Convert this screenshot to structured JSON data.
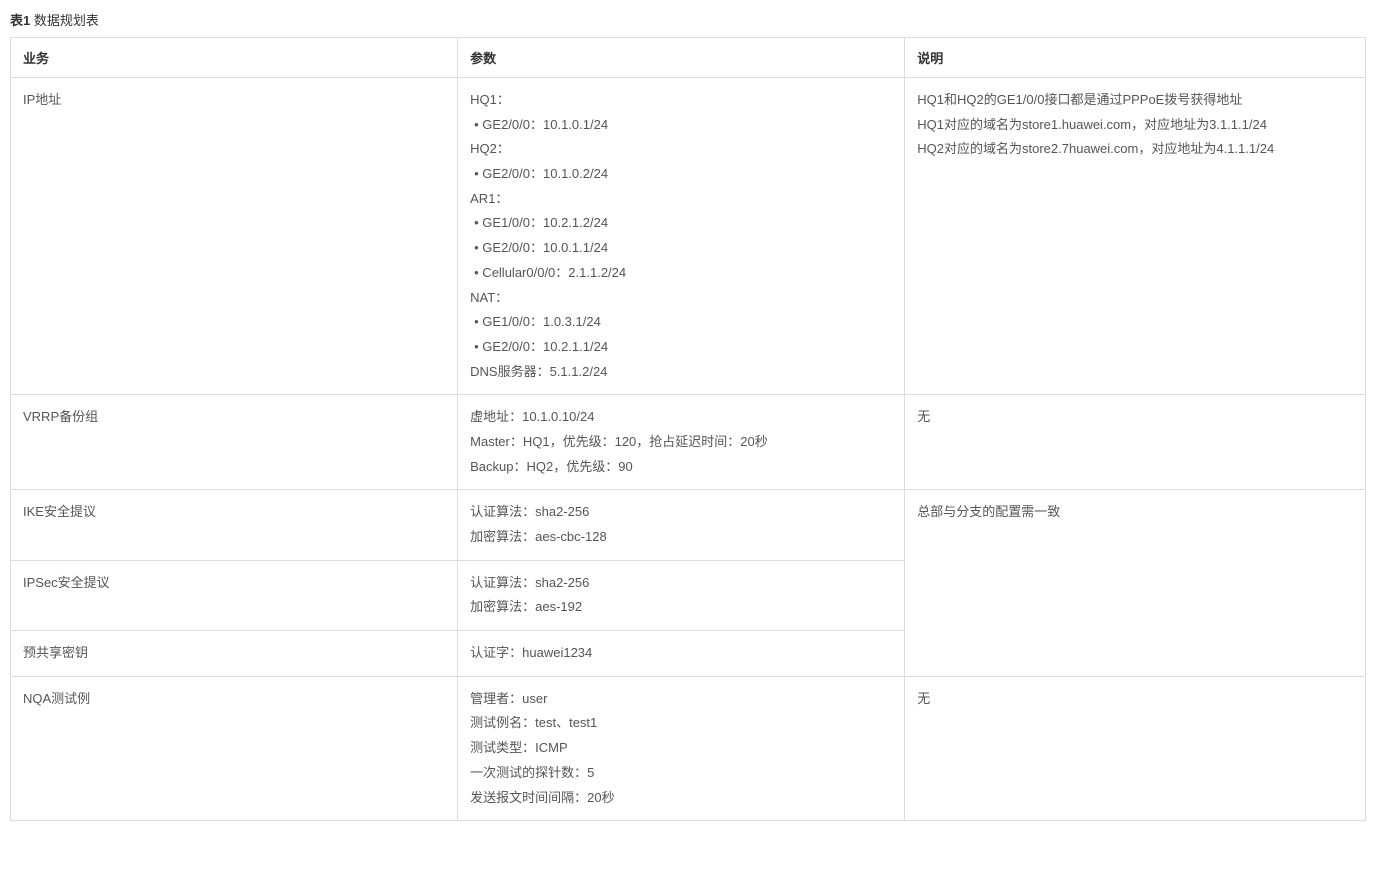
{
  "title_prefix": "表1",
  "title_text": " 数据规划表",
  "headers": {
    "col1": "业务",
    "col2": "参数",
    "col3": "说明"
  },
  "rows": {
    "ip": {
      "label": "IP地址",
      "params": {
        "hq1_label": "HQ1：",
        "hq1_ge2": "•  GE2/0/0：10.1.0.1/24",
        "hq2_label": "HQ2：",
        "hq2_ge2": "•  GE2/0/0：10.1.0.2/24",
        "ar1_label": "AR1：",
        "ar1_ge1": "•  GE1/0/0：10.2.1.2/24",
        "ar1_ge2": "•  GE2/0/0：10.0.1.1/24",
        "ar1_cell": "•  Cellular0/0/0：2.1.1.2/24",
        "nat_label": "NAT：",
        "nat_ge1": "•  GE1/0/0：1.0.3.1/24",
        "nat_ge2": "•  GE2/0/0：10.2.1.1/24",
        "dns": "DNS服务器：5.1.1.2/24"
      },
      "desc": {
        "line1": "HQ1和HQ2的GE1/0/0接口都是通过PPPoE拨号获得地址",
        "line2": "HQ1对应的域名为store1.huawei.com，对应地址为3.1.1.1/24",
        "line3": "HQ2对应的域名为store2.7huawei.com，对应地址为4.1.1.1/24"
      }
    },
    "vrrp": {
      "label": "VRRP备份组",
      "params": {
        "line1": "虚地址：10.1.0.10/24",
        "line2": "Master：HQ1，优先级：120，抢占延迟时间：20秒",
        "line3": "Backup：HQ2，优先级：90"
      },
      "desc": "无"
    },
    "ike": {
      "label": "IKE安全提议",
      "params": {
        "line1": "认证算法：sha2-256",
        "line2": "加密算法：aes-cbc-128"
      },
      "desc": "总部与分支的配置需一致"
    },
    "ipsec": {
      "label": "IPSec安全提议",
      "params": {
        "line1": "认证算法：sha2-256",
        "line2": "加密算法：aes-192"
      }
    },
    "psk": {
      "label": "预共享密钥",
      "params": {
        "line1": "认证字：huawei1234"
      }
    },
    "nqa": {
      "label": "NQA测试例",
      "params": {
        "line1": "管理者：user",
        "line2": "测试例名：test、test1",
        "line3": "测试类型：ICMP",
        "line4": "一次测试的探针数：5",
        "line5": "发送报文时间间隔：20秒"
      },
      "desc": "无"
    }
  }
}
